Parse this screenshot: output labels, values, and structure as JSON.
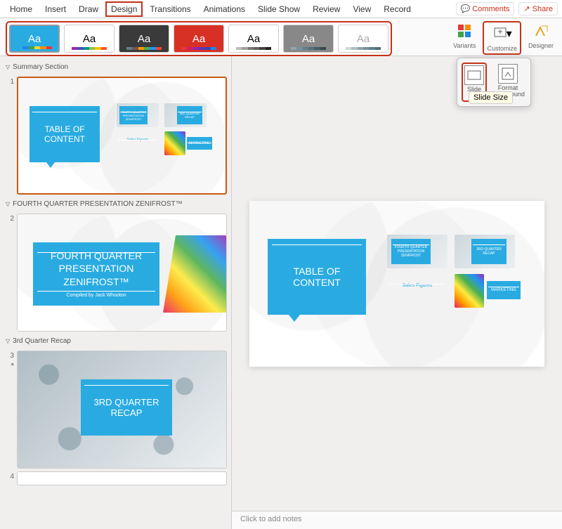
{
  "tabs": [
    "Home",
    "Insert",
    "Draw",
    "Design",
    "Transitions",
    "Animations",
    "Slide Show",
    "Review",
    "View",
    "Record"
  ],
  "active_tab": "Design",
  "actions": {
    "comments": "Comments",
    "share": "Share"
  },
  "ribbon": {
    "variants": "Variants",
    "customize": "Customize",
    "designer": "Designer"
  },
  "dropdown": {
    "slide_size": "Slide\nSize",
    "format_bg": "Format\nBackground",
    "tooltip": "Slide Size"
  },
  "sections": [
    {
      "name": "Summary Section",
      "slides": [
        {
          "num": "1",
          "type": "toc"
        }
      ]
    },
    {
      "name": "FOURTH QUARTER PRESENTATION ZENIFROST™",
      "slides": [
        {
          "num": "2",
          "type": "title"
        }
      ]
    },
    {
      "name": "3rd Quarter Recap",
      "slides": [
        {
          "num": "3",
          "type": "recap",
          "star": true
        },
        {
          "num": "4",
          "type": "blank"
        }
      ]
    }
  ],
  "slide_toc": {
    "title": "TABLE OF\nCONTENT",
    "mini1": "FOURTH QUARTER\nPRESENTATION\nZENIFROST",
    "mini2": "3RD QUARTER\nRECAP",
    "mini3": "Sales Figures",
    "mini4": "MARKETING"
  },
  "slide_title": {
    "line1": "FOURTH QUARTER",
    "line2": "PRESENTATION",
    "line3": "ZENIFROST™",
    "byline": "Compiled by Jack Whooton"
  },
  "slide_recap": {
    "title": "3RD QUARTER\nRECAP"
  },
  "notes_placeholder": "Click to add notes",
  "theme_colors": [
    [
      "#29abe2",
      "#1e88e5",
      "#43a047",
      "#fdd835",
      "#fb8c00",
      "#e53935"
    ],
    [
      "#9c27b0",
      "#3f51b5",
      "#009688",
      "#8bc34a",
      "#ffc107",
      "#ff5722"
    ],
    [
      "#607d8b",
      "#795548",
      "#ff9800",
      "#4caf50",
      "#2196f3",
      "#f44336"
    ],
    [
      "#e53935",
      "#d81b60",
      "#8e24aa",
      "#5e35b1",
      "#3949ab",
      "#1e88e5"
    ],
    [
      "#bdbdbd",
      "#9e9e9e",
      "#757575",
      "#616161",
      "#424242",
      "#212121"
    ],
    [
      "#90a4ae",
      "#78909c",
      "#607d8b",
      "#546e7a",
      "#455a64",
      "#37474f"
    ],
    [
      "#cfd8dc",
      "#b0bec5",
      "#90a4ae",
      "#78909c",
      "#607d8b",
      "#546e7a"
    ]
  ]
}
